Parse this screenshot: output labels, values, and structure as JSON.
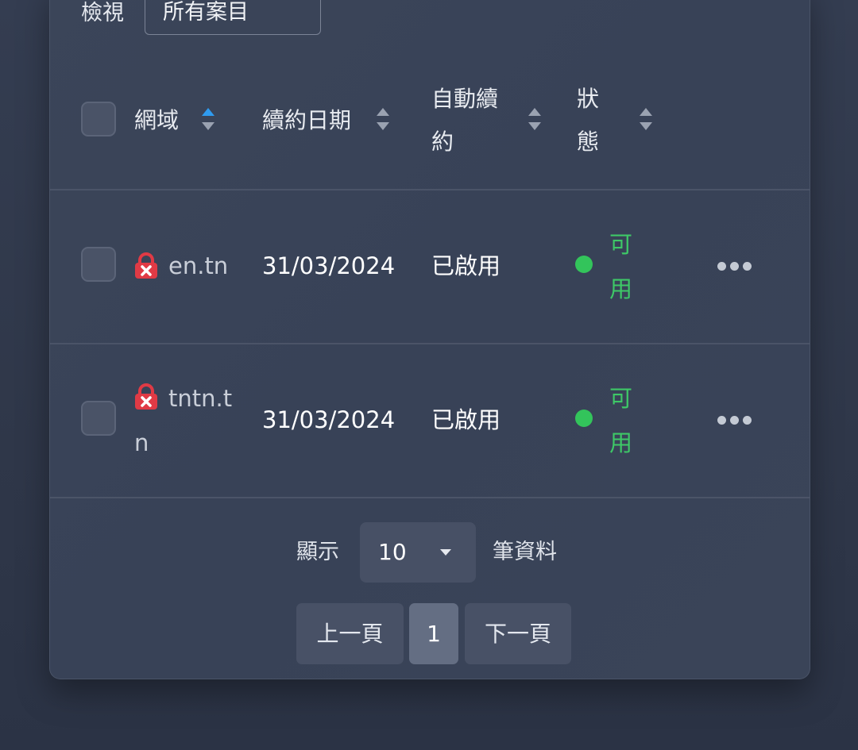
{
  "filter": {
    "label": "檢視",
    "selected": "所有案目"
  },
  "table": {
    "columns": [
      {
        "label": "網域",
        "sort": "active"
      },
      {
        "label": "續約日期",
        "sort": "none"
      },
      {
        "label": "自動續約",
        "sort": "none"
      },
      {
        "label": "狀態",
        "sort": "none"
      }
    ],
    "rows": [
      {
        "domain": "en.tn",
        "renew_date": "31/03/2024",
        "auto_renew": "已啟用",
        "status": "可用"
      },
      {
        "domain": "tntn.tn",
        "renew_date": "31/03/2024",
        "auto_renew": "已啟用",
        "status": "可用"
      }
    ]
  },
  "footer": {
    "show_label": "顯示",
    "page_size": "10",
    "records_label": "筆資料",
    "prev_label": "上一頁",
    "current_page": "1",
    "next_label": "下一頁"
  },
  "colors": {
    "status_green": "#33c45b",
    "lock_red": "#e03a45",
    "sort_active": "#2f9bef"
  }
}
